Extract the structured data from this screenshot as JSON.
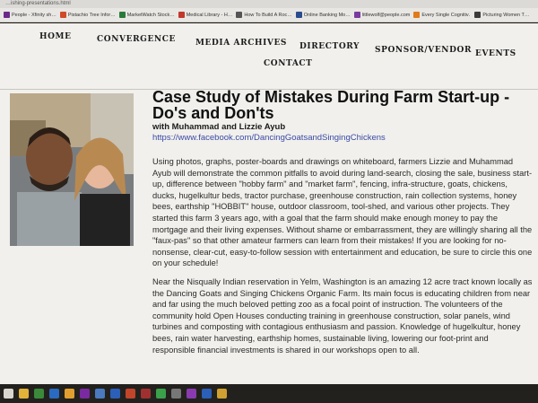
{
  "browser": {
    "url_fragment": "…ishing-presentations.html",
    "bookmarks": [
      {
        "label": "People - Xfinity sh…",
        "color": "#6a2a8a"
      },
      {
        "label": "Pistachio Tree Infor…",
        "color": "#d04a2a"
      },
      {
        "label": "MarketWatch Stock…",
        "color": "#2a7a3a"
      },
      {
        "label": "Medical Library - H…",
        "color": "#c0392b"
      },
      {
        "label": "How To Build A Roc…",
        "color": "#555555"
      },
      {
        "label": "Online Banking Mo…",
        "color": "#2b4d8f"
      },
      {
        "label": "littlewolf@people.com",
        "color": "#7a3aa0"
      },
      {
        "label": "Every Single Cognitiv…",
        "color": "#e07a1a"
      },
      {
        "label": "Picturing Women T…",
        "color": "#3a3a3a"
      }
    ]
  },
  "nav": {
    "home": "HOME",
    "convergence": "CONVERGENCE",
    "media_archives": "MEDIA ARCHIVES",
    "directory": "DIRECTORY",
    "sponsor_vendor": "SPONSOR/VENDOR",
    "events": "EVENTS",
    "contact": "CONTACT"
  },
  "article": {
    "title": "Case Study of Mistakes During Farm Start-up - Do's and Don'ts",
    "with_label": "with",
    "authors": "Muhammad and Lizzie Ayub",
    "link": "https://www.facebook.com/DancingGoatsandSingingChickens",
    "paragraph1": "Using photos, graphs, poster-boards and drawings on whiteboard, farmers Lizzie and Muhammad Ayub will demonstrate the common pitfalls to avoid during land-search, closing the sale, business start-up, difference between \"hobby farm\" and \"market farm\", fencing, infra-structure, goats, chickens, ducks, hugelkultur beds, tractor purchase, greenhouse construction, rain collection systems, honey bees, earthship \"HOBBIT\" house, outdoor classroom, tool-shed, and various other projects. They started this farm 3 years ago, with a goal that the farm should make enough money to pay the mortgage and their living expenses. Without shame or embarrassment, they are willingly sharing all the \"faux-pas\" so that other amateur farmers can learn from their mistakes! If you are looking for no-nonsense, clear-cut, easy-to-follow session with entertainment and education, be sure to circle this one on your schedule!",
    "paragraph2": "Near the Nisqually Indian reservation in Yelm, Washington is an amazing 12 acre tract known locally as the Dancing Goats and Singing Chickens Organic Farm. Its main focus is educating children from near and far using the much beloved petting zoo as a focal point of instruction. The volunteers of the community hold Open Houses conducting training in greenhouse construction, solar panels, wind turbines and composting with contagious enthusiasm and passion. Knowledge of hugelkultur, honey bees, rain water harvesting, earthship homes, sustainable living, lowering our foot-print and responsible financial investments is shared in our workshops open to all."
  },
  "taskbar": {
    "icons": [
      {
        "name": "start-icon",
        "color": "#d9d6cf"
      },
      {
        "name": "file-explorer-icon",
        "color": "#e0b23a"
      },
      {
        "name": "chrome-icon",
        "color": "#3a8a3a"
      },
      {
        "name": "outlook-icon",
        "color": "#2a6ac0"
      },
      {
        "name": "app-icon",
        "color": "#e0a030"
      },
      {
        "name": "onenote-icon",
        "color": "#7a2aa0"
      },
      {
        "name": "photos-icon",
        "color": "#4a7ac0"
      },
      {
        "name": "word-icon",
        "color": "#2b5fb8"
      },
      {
        "name": "powerpoint-icon",
        "color": "#c0452a"
      },
      {
        "name": "media-icon",
        "color": "#a03030"
      },
      {
        "name": "chrome2-icon",
        "color": "#3aa04a"
      },
      {
        "name": "settings-icon",
        "color": "#777777"
      },
      {
        "name": "onenote2-icon",
        "color": "#8a3ab0"
      },
      {
        "name": "word2-icon",
        "color": "#2b5fb8"
      },
      {
        "name": "explorer2-icon",
        "color": "#d0a030"
      }
    ]
  }
}
